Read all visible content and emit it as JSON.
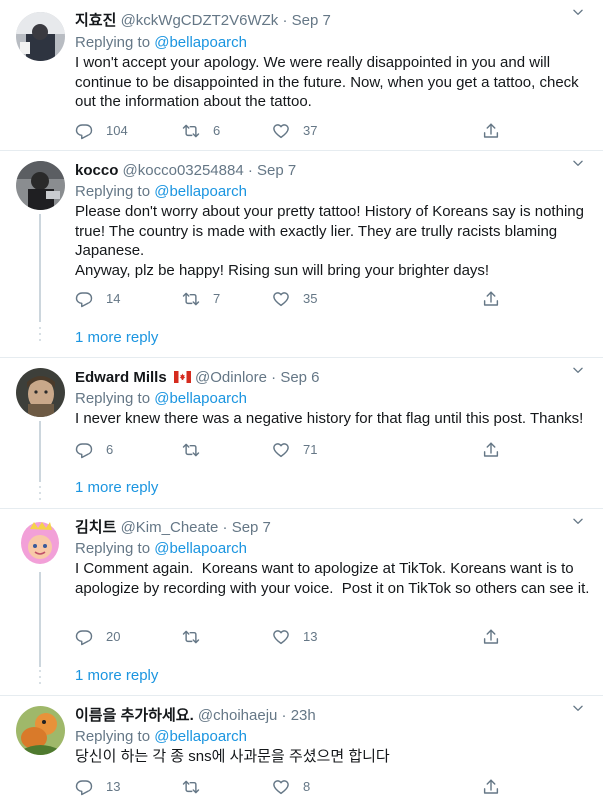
{
  "tweets": [
    {
      "name": "지효진",
      "handle": "@kckWgCDZT2V6WZk",
      "dot": "·",
      "date": "Sep 7",
      "replying_prefix": "Replying to",
      "replying_to": "@bellapoarch",
      "text": "I won't accept your apology. We were really disappointed in you and will continue to be disappointed in the future. Now, when you get a tattoo, check out the information about the tattoo.",
      "replies": "104",
      "retweets": "6",
      "likes": "37"
    },
    {
      "name": "kocco",
      "handle": "@kocco03254884",
      "dot": "·",
      "date": "Sep 7",
      "replying_prefix": "Replying to",
      "replying_to": "@bellapoarch",
      "text": "Please don't worry about your pretty tattoo! History of Koreans say is nothing true! The country is made with exactly lier. They are trully racists blaming Japanese.\nAnyway, plz be happy! Rising sun will bring your brighter days!",
      "replies": "14",
      "retweets": "7",
      "likes": "35",
      "more_replies": "1 more reply"
    },
    {
      "name": "Edward Mills",
      "flag": "canada-flag-icon",
      "handle": "@Odinlore",
      "dot": "·",
      "date": "Sep 6",
      "replying_prefix": "Replying to",
      "replying_to": "@bellapoarch",
      "text": "I never knew there was a negative history for that flag until this post. Thanks!",
      "replies": "6",
      "retweets": "",
      "likes": "71",
      "more_replies": "1 more reply"
    },
    {
      "name": "김치트",
      "handle": "@Kim_Cheate",
      "dot": "·",
      "date": "Sep 7",
      "replying_prefix": "Replying to",
      "replying_to": "@bellapoarch",
      "text": "I Comment again.  Koreans want to apologize at TikTok. Koreans want is to apologize by recording with your voice.  Post it on TikTok so others can see it.",
      "replies": "20",
      "retweets": "",
      "likes": "13",
      "more_replies": "1 more reply"
    },
    {
      "name": "이름을 추가하세요.",
      "handle": "@choihaeju",
      "dot": "·",
      "date": "23h",
      "replying_prefix": "Replying to",
      "replying_to": "@bellapoarch",
      "text": "당신이 하는 각 종 sns에 사과문을 주셨으면 합니다",
      "replies": "13",
      "retweets": "",
      "likes": "8"
    }
  ],
  "colors": {
    "text": "#14171a",
    "secondary": "#657786",
    "link": "#1b95e0",
    "border": "#e6ecf0",
    "thread": "#ccd6dd"
  },
  "icons": [
    "reply-icon",
    "retweet-icon",
    "like-icon",
    "share-icon",
    "chevron-down-icon",
    "canada-flag-icon"
  ]
}
